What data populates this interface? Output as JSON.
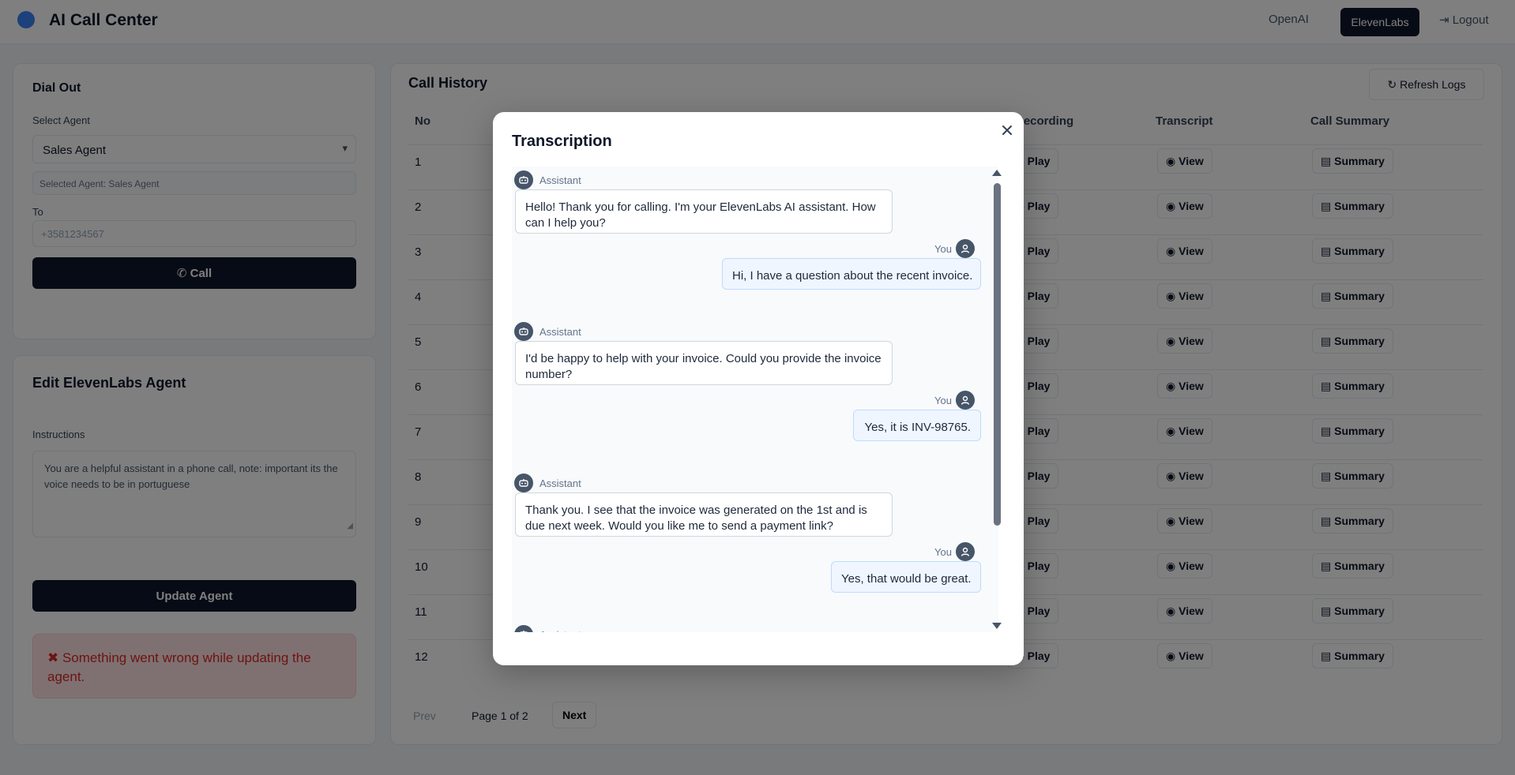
{
  "header": {
    "app_title": "AI Call Center",
    "nav": {
      "openai": "OpenAI",
      "elevenlabs": "ElevenLabs",
      "logout": "Logout"
    }
  },
  "dialer": {
    "title": "Dial Out",
    "select_label": "Select Agent",
    "selected_agent": "Sales Agent",
    "selected_info_prefix": "Selected Agent:",
    "selected_info_value": "Sales Agent",
    "to_label": "To",
    "phone_placeholder": "+3581234567",
    "call_button": "Call"
  },
  "edit_agent": {
    "title": "Edit ElevenLabs Agent",
    "instructions_label": "Instructions",
    "instructions_value": "You are a helpful assistant in a phone call, note: important its the voice needs to be in portuguese",
    "update_button": "Update Agent",
    "error_message": "Something went wrong while updating the agent."
  },
  "call_history": {
    "title": "Call History",
    "refresh_button": "Refresh Logs",
    "columns": [
      "No",
      "Recording",
      "Transcript",
      "Call Summary"
    ],
    "rows": [
      "1",
      "2",
      "3",
      "4",
      "5",
      "6",
      "7",
      "8",
      "9",
      "10",
      "11",
      "12"
    ],
    "play_label": "Play",
    "view_label": "View",
    "summary_label": "Summary",
    "pager": {
      "prev": "Prev",
      "info": "Page 1 of 2",
      "next": "Next"
    }
  },
  "modal": {
    "title": "Transcription",
    "assistant_label": "Assistant",
    "user_label": "You",
    "messages": [
      {
        "role": "assistant",
        "text": "Hello! Thank you for calling. I'm your ElevenLabs AI assistant. How can I help you?"
      },
      {
        "role": "user",
        "text": "Hi, I have a question about the recent invoice."
      },
      {
        "role": "assistant",
        "text": "I'd be happy to help with your invoice. Could you provide the invoice number?"
      },
      {
        "role": "user",
        "text": "Yes, it is INV-98765."
      },
      {
        "role": "assistant",
        "text": "Thank you. I see that the invoice was generated on the 1st and is due next week. Would you like me to send a payment link?"
      },
      {
        "role": "user",
        "text": "Yes, that would be great."
      },
      {
        "role": "assistant",
        "text": ""
      }
    ]
  },
  "colors": {
    "primary_dark": "#0f172a",
    "overlay": "rgba(0,0,0,0.5)",
    "user_bubble": "#eff6ff",
    "error_text": "#dc2626",
    "avatar": "#475569"
  }
}
